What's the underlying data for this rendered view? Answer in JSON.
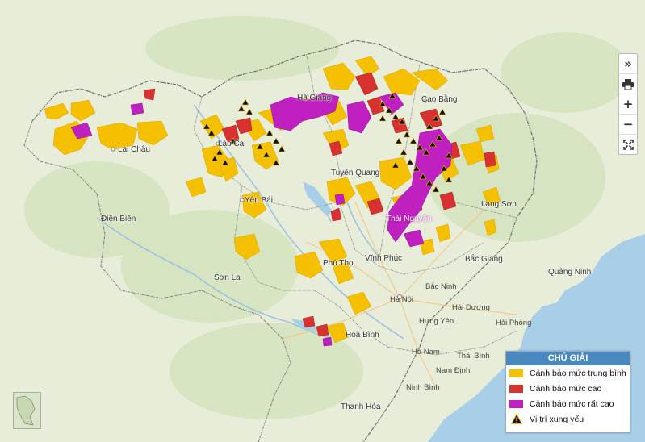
{
  "colors": {
    "medium": "#f5c000",
    "high": "#d93030",
    "very_high": "#c020c0",
    "water": "#a9cfe8",
    "land": "#e6ecd6",
    "legend_header": "#4a88c0"
  },
  "legend": {
    "title": "CHÚ GIẢI",
    "items": [
      {
        "label": "Cảnh báo mức trung bình",
        "color": "#f5c000"
      },
      {
        "label": "Cảnh báo mức cao",
        "color": "#d93030"
      },
      {
        "label": "Cảnh báo mức rất cao",
        "color": "#c020c0"
      },
      {
        "label": "Vị trí xung yếu",
        "icon": "warning-triangle-icon"
      }
    ]
  },
  "controls": {
    "expand": "»",
    "print_icon": "printer-icon",
    "zoom_in": "+",
    "zoom_out": "−",
    "fullscreen_icon": "fullscreen-icon"
  },
  "places": {
    "cao_bang": "Cao Bằng",
    "lai_chau": "Lai Châu",
    "lao_cai": "Lào Cai",
    "ha_giang": "Hà Giang",
    "tuyen_quang": "Tuyên Quang",
    "dien_bien": "Điện Biên",
    "yen_bai": "Yên Bái",
    "lang_son": "Lạng Sơn",
    "thai_nguyen": "Thái Nguyên",
    "phu_tho": "Phú Thọ",
    "vinh_phuc": "Vĩnh Phúc",
    "bac_giang": "Bắc Giang",
    "son_la": "Sơn La",
    "quang_ninh": "Quảng Ninh",
    "bac_ninh": "Bắc Ninh",
    "ha_noi": "Hà Nội",
    "hai_duong": "Hải Dương",
    "hung_yen": "Hưng Yên",
    "hai_phong": "Hải Phòng",
    "hoa_binh": "Hoà Bình",
    "ha_nam": "Hà Nam",
    "thai_binh": "Thái Bình",
    "nam_dinh": "Nam Định",
    "ninh_binh": "Ninh Bình",
    "thanh_hoa": "Thanh Hóa"
  }
}
